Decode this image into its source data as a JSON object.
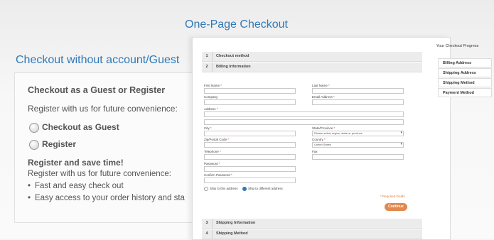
{
  "guest": {
    "title": "Checkout without account/Guest",
    "heading": "Checkout as a Guest or Register",
    "subtitle": "Register with us for future convenience:",
    "options": [
      "Checkout as Guest",
      "Register"
    ],
    "register_heading": "Register and save time!",
    "register_text": "Register with us for future convenience:",
    "bullets": [
      "Fast and easy check out",
      "Easy access to your order history and sta"
    ]
  },
  "onepage": {
    "title": "One-Page Checkout",
    "sections": [
      {
        "num": "1",
        "label": "Checkout method"
      },
      {
        "num": "2",
        "label": "Billing Information"
      },
      {
        "num": "3",
        "label": "Shipping Information"
      },
      {
        "num": "4",
        "label": "Shipping Method"
      }
    ],
    "fields": {
      "first_name": "First Name",
      "last_name": "Last Name",
      "company": "Company",
      "email": "Email Address",
      "address": "Address",
      "city": "City",
      "state": "State/Province",
      "state_value": "Please select region, state or province",
      "zip": "Zip/Postal Code",
      "country": "Country",
      "country_value": "United States",
      "telephone": "Telephone",
      "fax": "Fax",
      "password": "Password",
      "confirm_password": "Confirm Password"
    },
    "ship_same": "Ship to this address",
    "ship_diff": "Ship to different address",
    "required_note": "* Required Fields",
    "continue": "Continue"
  },
  "progress": {
    "title": "Your Checkout Progress",
    "items": [
      "Billing Address",
      "Shipping Address",
      "Shipping Method",
      "Payment Method"
    ]
  }
}
